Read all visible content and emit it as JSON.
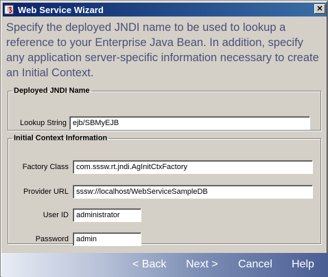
{
  "window": {
    "title": "Web Service Wizard",
    "close_glyph": "✕"
  },
  "header": {
    "instruction": "Specify the deployed JNDI name to be used to lookup a reference to your Enterprise Java Bean. In addition, specify any application server-specific  information necessary to create an Initial Context."
  },
  "deployed_jndi": {
    "legend": "Deployed JNDI Name",
    "lookup_label": "Lookup String",
    "lookup_value": "ejb/SBMyEJB"
  },
  "initial_context": {
    "legend": "Initial Context Information",
    "factory_label": "Factory Class",
    "factory_value": "com.sssw.rt.jndi.AgInitCtxFactory",
    "provider_label": "Provider URL",
    "provider_value": "sssw://localhost/WebServiceSampleDB",
    "userid_label": "User ID",
    "userid_value": "administrator",
    "password_label": "Password",
    "password_value": "admin"
  },
  "buttons": {
    "back": "< Back",
    "next": "Next >",
    "cancel": "Cancel",
    "help": "Help"
  },
  "colors": {
    "titlebar_start": "#0a246a",
    "titlebar_end": "#3a6ea5",
    "header_text": "#4a4f7a",
    "dialog_bg": "#d4d0c8"
  }
}
